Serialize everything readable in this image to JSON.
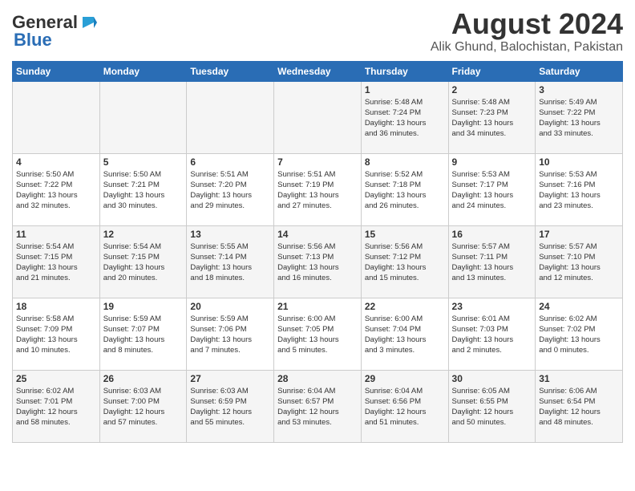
{
  "logo": {
    "line1": "General",
    "line2": "Blue"
  },
  "title": "August 2024",
  "subtitle": "Alik Ghund, Balochistan, Pakistan",
  "headers": [
    "Sunday",
    "Monday",
    "Tuesday",
    "Wednesday",
    "Thursday",
    "Friday",
    "Saturday"
  ],
  "weeks": [
    [
      {
        "day": "",
        "info": ""
      },
      {
        "day": "",
        "info": ""
      },
      {
        "day": "",
        "info": ""
      },
      {
        "day": "",
        "info": ""
      },
      {
        "day": "1",
        "info": "Sunrise: 5:48 AM\nSunset: 7:24 PM\nDaylight: 13 hours\nand 36 minutes."
      },
      {
        "day": "2",
        "info": "Sunrise: 5:48 AM\nSunset: 7:23 PM\nDaylight: 13 hours\nand 34 minutes."
      },
      {
        "day": "3",
        "info": "Sunrise: 5:49 AM\nSunset: 7:22 PM\nDaylight: 13 hours\nand 33 minutes."
      }
    ],
    [
      {
        "day": "4",
        "info": "Sunrise: 5:50 AM\nSunset: 7:22 PM\nDaylight: 13 hours\nand 32 minutes."
      },
      {
        "day": "5",
        "info": "Sunrise: 5:50 AM\nSunset: 7:21 PM\nDaylight: 13 hours\nand 30 minutes."
      },
      {
        "day": "6",
        "info": "Sunrise: 5:51 AM\nSunset: 7:20 PM\nDaylight: 13 hours\nand 29 minutes."
      },
      {
        "day": "7",
        "info": "Sunrise: 5:51 AM\nSunset: 7:19 PM\nDaylight: 13 hours\nand 27 minutes."
      },
      {
        "day": "8",
        "info": "Sunrise: 5:52 AM\nSunset: 7:18 PM\nDaylight: 13 hours\nand 26 minutes."
      },
      {
        "day": "9",
        "info": "Sunrise: 5:53 AM\nSunset: 7:17 PM\nDaylight: 13 hours\nand 24 minutes."
      },
      {
        "day": "10",
        "info": "Sunrise: 5:53 AM\nSunset: 7:16 PM\nDaylight: 13 hours\nand 23 minutes."
      }
    ],
    [
      {
        "day": "11",
        "info": "Sunrise: 5:54 AM\nSunset: 7:15 PM\nDaylight: 13 hours\nand 21 minutes."
      },
      {
        "day": "12",
        "info": "Sunrise: 5:54 AM\nSunset: 7:15 PM\nDaylight: 13 hours\nand 20 minutes."
      },
      {
        "day": "13",
        "info": "Sunrise: 5:55 AM\nSunset: 7:14 PM\nDaylight: 13 hours\nand 18 minutes."
      },
      {
        "day": "14",
        "info": "Sunrise: 5:56 AM\nSunset: 7:13 PM\nDaylight: 13 hours\nand 16 minutes."
      },
      {
        "day": "15",
        "info": "Sunrise: 5:56 AM\nSunset: 7:12 PM\nDaylight: 13 hours\nand 15 minutes."
      },
      {
        "day": "16",
        "info": "Sunrise: 5:57 AM\nSunset: 7:11 PM\nDaylight: 13 hours\nand 13 minutes."
      },
      {
        "day": "17",
        "info": "Sunrise: 5:57 AM\nSunset: 7:10 PM\nDaylight: 13 hours\nand 12 minutes."
      }
    ],
    [
      {
        "day": "18",
        "info": "Sunrise: 5:58 AM\nSunset: 7:09 PM\nDaylight: 13 hours\nand 10 minutes."
      },
      {
        "day": "19",
        "info": "Sunrise: 5:59 AM\nSunset: 7:07 PM\nDaylight: 13 hours\nand 8 minutes."
      },
      {
        "day": "20",
        "info": "Sunrise: 5:59 AM\nSunset: 7:06 PM\nDaylight: 13 hours\nand 7 minutes."
      },
      {
        "day": "21",
        "info": "Sunrise: 6:00 AM\nSunset: 7:05 PM\nDaylight: 13 hours\nand 5 minutes."
      },
      {
        "day": "22",
        "info": "Sunrise: 6:00 AM\nSunset: 7:04 PM\nDaylight: 13 hours\nand 3 minutes."
      },
      {
        "day": "23",
        "info": "Sunrise: 6:01 AM\nSunset: 7:03 PM\nDaylight: 13 hours\nand 2 minutes."
      },
      {
        "day": "24",
        "info": "Sunrise: 6:02 AM\nSunset: 7:02 PM\nDaylight: 13 hours\nand 0 minutes."
      }
    ],
    [
      {
        "day": "25",
        "info": "Sunrise: 6:02 AM\nSunset: 7:01 PM\nDaylight: 12 hours\nand 58 minutes."
      },
      {
        "day": "26",
        "info": "Sunrise: 6:03 AM\nSunset: 7:00 PM\nDaylight: 12 hours\nand 57 minutes."
      },
      {
        "day": "27",
        "info": "Sunrise: 6:03 AM\nSunset: 6:59 PM\nDaylight: 12 hours\nand 55 minutes."
      },
      {
        "day": "28",
        "info": "Sunrise: 6:04 AM\nSunset: 6:57 PM\nDaylight: 12 hours\nand 53 minutes."
      },
      {
        "day": "29",
        "info": "Sunrise: 6:04 AM\nSunset: 6:56 PM\nDaylight: 12 hours\nand 51 minutes."
      },
      {
        "day": "30",
        "info": "Sunrise: 6:05 AM\nSunset: 6:55 PM\nDaylight: 12 hours\nand 50 minutes."
      },
      {
        "day": "31",
        "info": "Sunrise: 6:06 AM\nSunset: 6:54 PM\nDaylight: 12 hours\nand 48 minutes."
      }
    ]
  ]
}
